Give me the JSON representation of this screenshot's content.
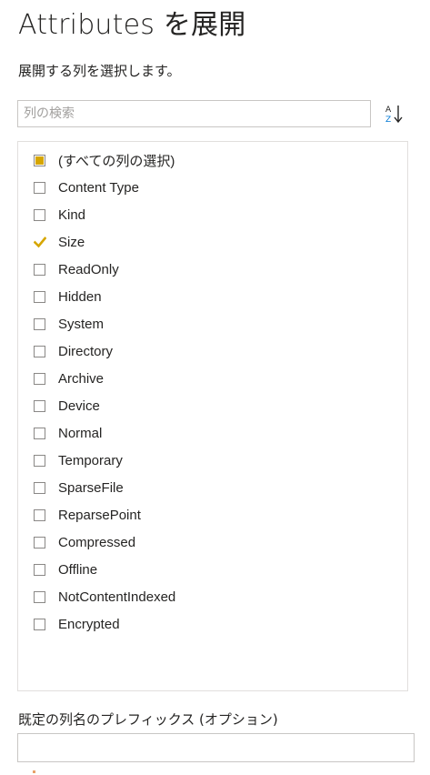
{
  "dialog": {
    "title": "Attributes を展開",
    "subtitle": "展開する列を選択します。"
  },
  "search": {
    "placeholder": "列の検索",
    "value": ""
  },
  "sort_button": {
    "icon": "sort-ascending-az-icon",
    "letter_top": "A",
    "letter_bottom": "Z"
  },
  "columns": {
    "items": [
      {
        "label": "(すべての列の選択)",
        "state": "partial"
      },
      {
        "label": "Content Type",
        "state": "unchecked"
      },
      {
        "label": "Kind",
        "state": "unchecked"
      },
      {
        "label": "Size",
        "state": "checked"
      },
      {
        "label": "ReadOnly",
        "state": "unchecked"
      },
      {
        "label": "Hidden",
        "state": "unchecked"
      },
      {
        "label": "System",
        "state": "unchecked"
      },
      {
        "label": "Directory",
        "state": "unchecked"
      },
      {
        "label": "Archive",
        "state": "unchecked"
      },
      {
        "label": "Device",
        "state": "unchecked"
      },
      {
        "label": "Normal",
        "state": "unchecked"
      },
      {
        "label": "Temporary",
        "state": "unchecked"
      },
      {
        "label": "SparseFile",
        "state": "unchecked"
      },
      {
        "label": "ReparsePoint",
        "state": "unchecked"
      },
      {
        "label": "Compressed",
        "state": "unchecked"
      },
      {
        "label": "Offline",
        "state": "unchecked"
      },
      {
        "label": "NotContentIndexed",
        "state": "unchecked"
      },
      {
        "label": "Encrypted",
        "state": "unchecked"
      }
    ]
  },
  "prefix": {
    "label": "既定の列名のプレフィックス (オプション)",
    "value": ""
  },
  "colors": {
    "accent": "#d6a600",
    "text": "#252423",
    "border": "#c8c6c4"
  }
}
